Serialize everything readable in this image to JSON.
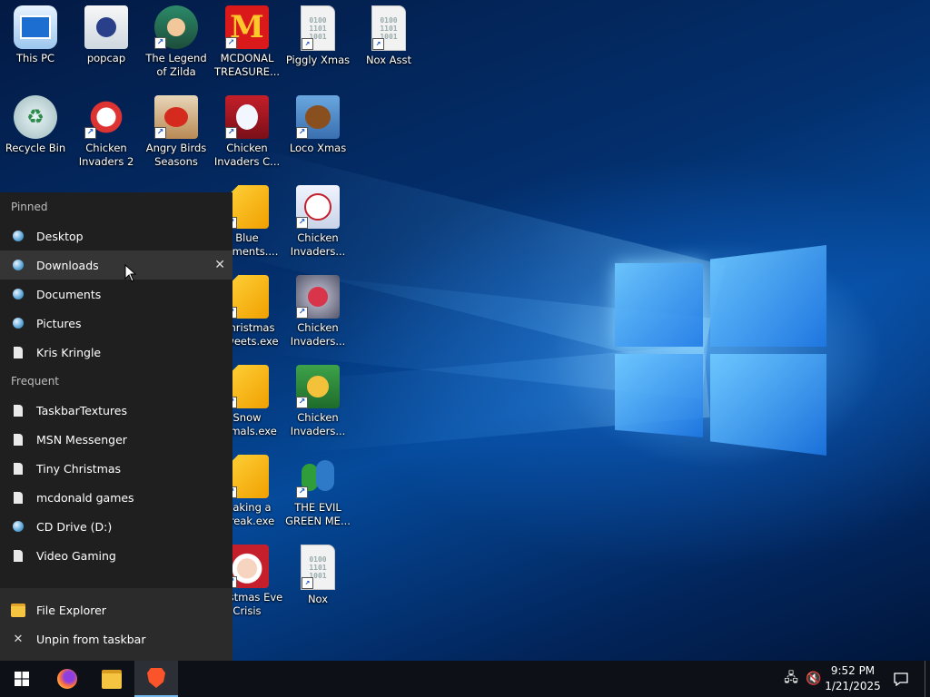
{
  "desktop_icons": [
    {
      "label": "This PC",
      "type": "pc"
    },
    {
      "label": "popcap",
      "type": "folder-file"
    },
    {
      "label": "The Legend of Zilda",
      "type": "game-zilda",
      "shortcut": true
    },
    {
      "label": "MCDONAL TREASURE...",
      "type": "game-mcd",
      "shortcut": true
    },
    {
      "label": "Piggly Xmas",
      "type": "bin-doc",
      "shortcut": true
    },
    {
      "label": "Nox Asst",
      "type": "bin-doc",
      "shortcut": true
    },
    {
      "label": "Recycle Bin",
      "type": "recycle"
    },
    {
      "label": "Chicken Invaders 2",
      "type": "chicken2",
      "shortcut": true
    },
    {
      "label": "Angry Birds Seasons",
      "type": "angry",
      "shortcut": true
    },
    {
      "label": "Chicken Invaders C...",
      "type": "snowman",
      "shortcut": true
    },
    {
      "label": "Loco Xmas",
      "type": "bear",
      "shortcut": true
    },
    {
      "label": "Blue ...aments....",
      "type": "exe",
      "shortcut": true
    },
    {
      "label": "Chicken Invaders...",
      "type": "chicken",
      "shortcut": true
    },
    {
      "label": "...hristmas ...weets.exe",
      "type": "exe",
      "shortcut": true
    },
    {
      "label": "Chicken Invaders...",
      "type": "chicken",
      "shortcut": true
    },
    {
      "label": "Snow ...imals.exe",
      "type": "exe",
      "shortcut": true
    },
    {
      "label": "Chicken Invaders...",
      "type": "chicken",
      "shortcut": true
    },
    {
      "label": "...aking a ...reak.exe",
      "type": "exe",
      "shortcut": true
    },
    {
      "label": "THE EVIL GREEN ME...",
      "type": "msn",
      "shortcut": true
    },
    {
      "label": "...ristmas Eve Crisis",
      "type": "santa",
      "shortcut": true
    },
    {
      "label": "Nox",
      "type": "bin-doc",
      "shortcut": true
    }
  ],
  "jumplist": {
    "pinned_header": "Pinned",
    "pinned": [
      {
        "label": "Desktop",
        "icon": "globe-icon"
      },
      {
        "label": "Downloads",
        "icon": "globe-icon",
        "hover": true
      },
      {
        "label": "Documents",
        "icon": "globe-icon"
      },
      {
        "label": "Pictures",
        "icon": "globe-icon"
      },
      {
        "label": "Kris Kringle",
        "icon": "page-icon"
      }
    ],
    "frequent_header": "Frequent",
    "frequent": [
      {
        "label": "TaskbarTextures",
        "icon": "page-icon"
      },
      {
        "label": "MSN Messenger",
        "icon": "page-icon"
      },
      {
        "label": "Tiny Christmas",
        "icon": "page-icon"
      },
      {
        "label": "mcdonald games",
        "icon": "page-icon"
      },
      {
        "label": "CD Drive (D:)",
        "icon": "globe-icon"
      },
      {
        "label": "Video Gaming",
        "icon": "page-icon"
      }
    ],
    "file_explorer": "File Explorer",
    "unpin": "Unpin from taskbar"
  },
  "taskbar": {
    "time": "9:52 PM",
    "date": "1/21/2025"
  },
  "colors": {
    "accent": "#0078d7",
    "jumplist_bg": "#1f1f1f",
    "taskbar_bg": "#0d1117"
  }
}
